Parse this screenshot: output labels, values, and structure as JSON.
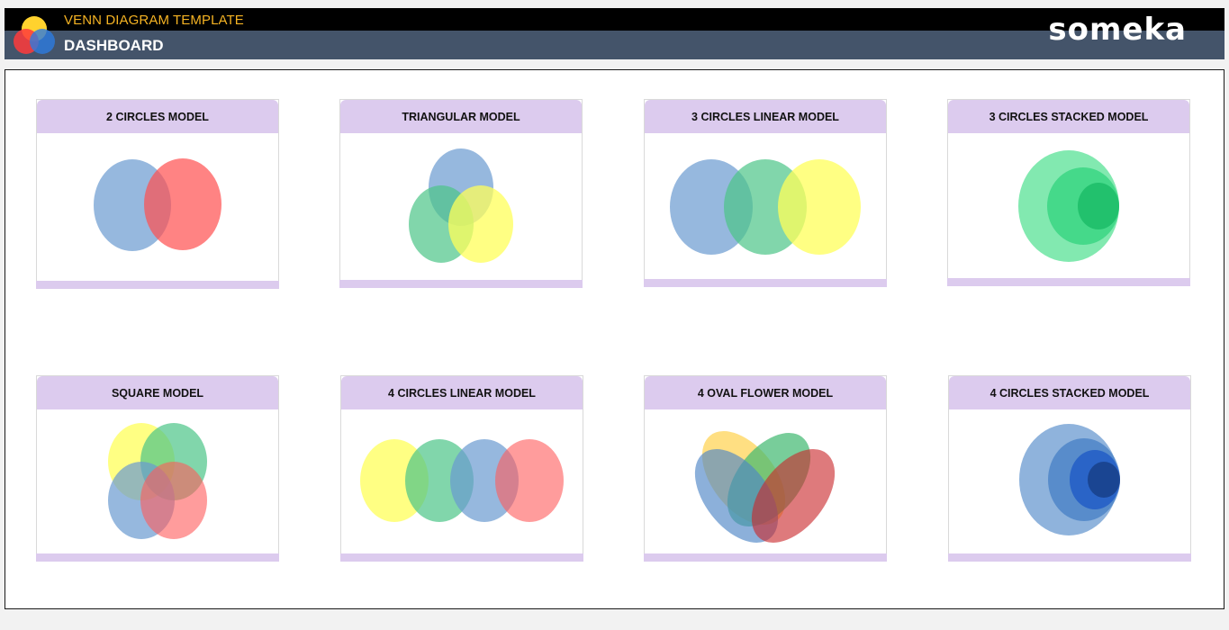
{
  "header": {
    "title": "VENN DIAGRAM TEMPLATE",
    "subtitle": "DASHBOARD",
    "brand": "someka",
    "colors": {
      "title": "#f5b323",
      "bar_top": "#000000",
      "bar_bottom": "#44546a"
    }
  },
  "cards": [
    {
      "id": "two-circles",
      "label": "2 CIRCLES MODEL"
    },
    {
      "id": "triangular",
      "label": "TRIANGULAR MODEL"
    },
    {
      "id": "three-circles-linear",
      "label": "3 CIRCLES LINEAR MODEL"
    },
    {
      "id": "three-circles-stacked",
      "label": "3 CIRCLES STACKED MODEL"
    },
    {
      "id": "square",
      "label": "SQUARE MODEL"
    },
    {
      "id": "four-circles-linear",
      "label": "4 CIRCLES LINEAR MODEL"
    },
    {
      "id": "four-oval-flower",
      "label": "4 OVAL FLOWER MODEL"
    },
    {
      "id": "four-circles-stacked",
      "label": "4 CIRCLES STACKED MODEL"
    }
  ],
  "palette": {
    "blue": "#6a9ad0",
    "red": "#ff5a5a",
    "green": "#4cc487",
    "yellow": "#ffff5a",
    "card_header": "#dccbee"
  }
}
